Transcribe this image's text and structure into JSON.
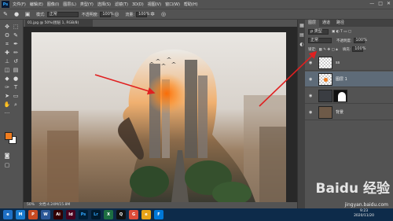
{
  "app": {
    "logo": "Ps"
  },
  "menubar": [
    "文件(F)",
    "编辑(E)",
    "图像(I)",
    "图层(L)",
    "类型(Y)",
    "选择(S)",
    "滤镜(T)",
    "3D(D)",
    "视图(V)",
    "窗口(W)",
    "帮助(H)"
  ],
  "window_controls": [
    "—",
    "□",
    "✕"
  ],
  "options": {
    "mode_label": "模式:",
    "mode_value": "正常",
    "opacity_label": "不透明度:",
    "opacity_value": "100%",
    "flow_label": "流量:",
    "flow_value": "100%"
  },
  "document": {
    "tab_title": "01.jpg @ 50%(图层 1, RGB/8)",
    "status_zoom": "50%",
    "status_doc": "文档:4.24M/15.8M"
  },
  "layers_panel": {
    "tabs": [
      "图层",
      "通道",
      "路径"
    ],
    "kind_label": "ρ 类型",
    "blend_mode": "正常",
    "opacity_label": "不透明度:",
    "opacity_value": "100%",
    "lock_label": "锁定:",
    "fill_label": "填充:",
    "fill_value": "100%",
    "layers": [
      {
        "name": "ss",
        "visible": true
      },
      {
        "name": "图层 1",
        "visible": true,
        "selected": true
      },
      {
        "name": "",
        "visible": true
      },
      {
        "name": "背景",
        "visible": true
      }
    ]
  },
  "taskbar": {
    "apps": [
      "e",
      "M",
      "P",
      "W",
      "Ai",
      "Id",
      "Ps",
      "Lr",
      "X",
      "Q",
      "G",
      "e",
      "F"
    ],
    "clock_time": "9:23",
    "clock_date": "2020/11/20"
  },
  "watermark": {
    "text": "Baidu 经验",
    "sub": "jingyan.baidu.com"
  },
  "colors": {
    "foreground": "#f07d1f",
    "background": "#ffffff",
    "annotation_arrow": "#e02020"
  }
}
